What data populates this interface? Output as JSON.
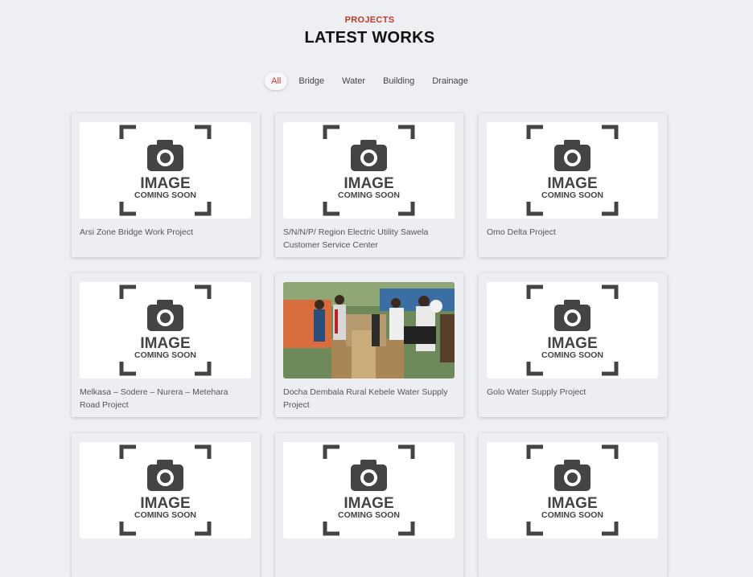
{
  "section": {
    "subtitle": "PROJECTS",
    "title": "LATEST WORKS"
  },
  "filters": [
    "All",
    "Bridge",
    "Water",
    "Building",
    "Drainage"
  ],
  "placeholder": {
    "line1": "IMAGE",
    "line2": "COMING SOON"
  },
  "projects": [
    {
      "title": "Arsi Zone Bridge Work Project",
      "image": "placeholder"
    },
    {
      "title": "S/N/N/P/ Region Electric Utility Sawela Customer Service Center",
      "image": "placeholder"
    },
    {
      "title": "Omo Delta Project",
      "image": "placeholder"
    },
    {
      "title": "Melkasa – Sodere – Nurera – Metehara Road Project",
      "image": "placeholder"
    },
    {
      "title": "Docha Dembala Rural Kebele Water Supply Project",
      "image": "photo"
    },
    {
      "title": "Golo Water Supply Project",
      "image": "placeholder"
    },
    {
      "title": "",
      "image": "placeholder"
    },
    {
      "title": "",
      "image": "placeholder"
    },
    {
      "title": "",
      "image": "placeholder"
    }
  ],
  "colors": {
    "accent": "#c0392b",
    "background": "#eeeff3"
  }
}
